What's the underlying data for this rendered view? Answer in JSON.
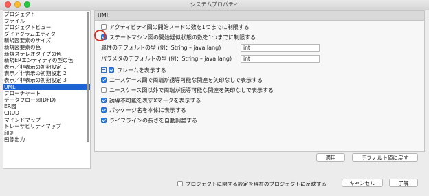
{
  "window": {
    "title": "システムプロパティ"
  },
  "sidebar": {
    "items": [
      "プロジェクト",
      "ファイル",
      "プロジェクトビュー",
      "ダイアグラムエディタ",
      "新規図要素のサイズ",
      "新規図要素の色",
      "新規ステレオタイプの色",
      "新規ERエンティティの型の色",
      "表示／非表示の初期設定 1",
      "表示／非表示の初期設定 2",
      "表示／非表示の初期設定 3",
      "UML",
      "フローチャート",
      "データフロー図(DFD)",
      "ER図",
      "CRUD",
      "マインドマップ",
      "トレーサビリティマップ",
      "印刷",
      "画像出力"
    ],
    "selected_index": 11
  },
  "panel": {
    "header": "UML",
    "options": [
      {
        "label": "アクティビティ図の開始ノードの数を1つまでに制限する",
        "checked": false
      },
      {
        "label": "ステートマシン図の開始疑似状態の数を1つまでに制限する",
        "checked": true
      }
    ],
    "attribute_type_label": "属性のデフォルトの型 (例：String – java.lang)",
    "attribute_type_value": "int",
    "parameter_type_label": "パラメタのデフォルトの型 (例：String – java.lang)",
    "parameter_type_value": "int",
    "frame_option": {
      "label": "フレームを表示する",
      "checked": true,
      "icon": "frame-icon"
    },
    "options2": [
      {
        "label": "ユースケース図で両端が誘導可能な関連を矢印なしで表示する",
        "checked": true
      },
      {
        "label": "ユースケース図以外で両端が誘導可能な関連を矢印なしで表示する",
        "checked": false
      },
      {
        "label": "誘導不可能を表すXマークを表示する",
        "checked": true
      },
      {
        "label": "パッケージ名を本体に表示する",
        "checked": true
      },
      {
        "label": "ライフラインの長さを自動調整する",
        "checked": true
      }
    ],
    "apply_button": "適用",
    "defaults_button": "デフォルト値に戻す"
  },
  "footer": {
    "reflect_label": "プロジェクトに関する設定を現在のプロジェクトに反映する",
    "reflect_checked": false,
    "cancel_button": "キャンセル",
    "ok_button": "了解"
  },
  "colors": {
    "accent": "#1b63d3",
    "checkbox_on": "#2c7ee6",
    "highlight": "#d33528"
  }
}
